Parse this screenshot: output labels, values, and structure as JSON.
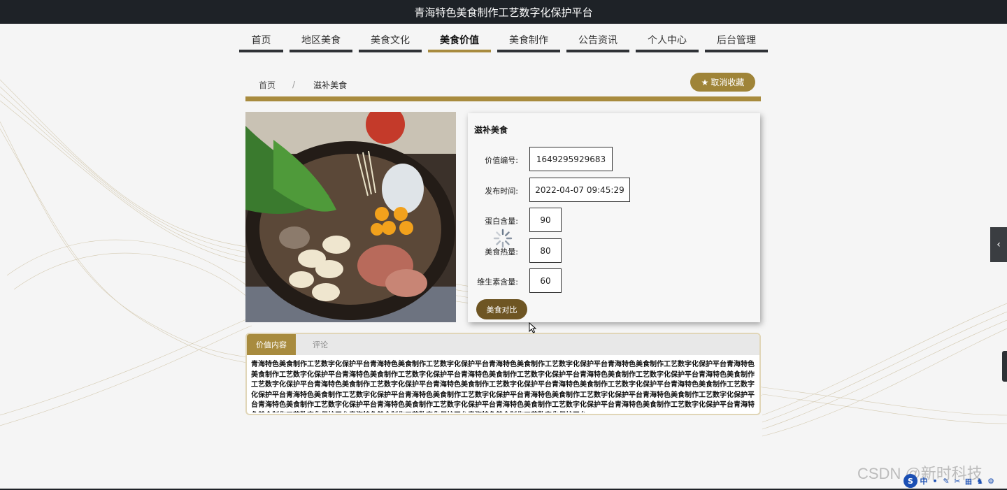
{
  "header": {
    "title": "青海特色美食制作工艺数字化保护平台"
  },
  "nav": {
    "items": [
      {
        "label": "首页"
      },
      {
        "label": "地区美食"
      },
      {
        "label": "美食文化"
      },
      {
        "label": "美食价值",
        "active": true
      },
      {
        "label": "美食制作"
      },
      {
        "label": "公告资讯"
      },
      {
        "label": "个人中心"
      },
      {
        "label": "后台管理"
      }
    ]
  },
  "breadcrumb": {
    "home": "首页",
    "separator": "/",
    "current": "滋补美食"
  },
  "favorite_button": {
    "label": "取消收藏",
    "icon": "star-icon"
  },
  "detail": {
    "title": "滋补美食",
    "fields": [
      {
        "label": "价值编号:",
        "value": "1649295929683"
      },
      {
        "label": "发布时间:",
        "value": "2022-04-07 09:45:29"
      },
      {
        "label": "蛋白含量:",
        "value": "90"
      },
      {
        "label": "美食热量:",
        "value": "80"
      },
      {
        "label": "维生素含量:",
        "value": "60"
      }
    ],
    "compare_button": "美食对比"
  },
  "tabs": {
    "items": [
      {
        "label": "价值内容",
        "active": true
      },
      {
        "label": "评论"
      }
    ],
    "content": "青海特色美食制作工艺数字化保护平台青海特色美食制作工艺数字化保护平台青海特色美食制作工艺数字化保护平台青海特色美食制作工艺数字化保护平台青海特色美食制作工艺数字化保护平台青海特色美食制作工艺数字化保护平台青海特色美食制作工艺数字化保护平台青海特色美食制作工艺数字化保护平台青海特色美食制作工艺数字化保护平台青海特色美食制作工艺数字化保护平台青海特色美食制作工艺数字化保护平台青海特色美食制作工艺数字化保护平台青海特色美食制作工艺数字化保护平台青海特色美食制作工艺数字化保护平台青海特色美食制作工艺数字化保护平台青海特色美食制作工艺数字化保护平台青海特色美食制作工艺数字化保护平台青海特色美食制作工艺数字化保护平台青海特色美食制作工艺数字化保护平台青海特色美食制作工艺数字化保护平台青海特色美食制作工艺数字化保护平台青海特色美食制作工艺数字化保护平台青海特色美食制作工艺数字化保护平台青海特色美食制作工艺数字化保护平台"
  },
  "watermark": "CSDN @新时科技",
  "ime_toolbar": {
    "logo": "S",
    "mode": "中"
  },
  "colors": {
    "accent": "#a88b3e",
    "topbar": "#1e2227",
    "compare": "#6e5523"
  }
}
